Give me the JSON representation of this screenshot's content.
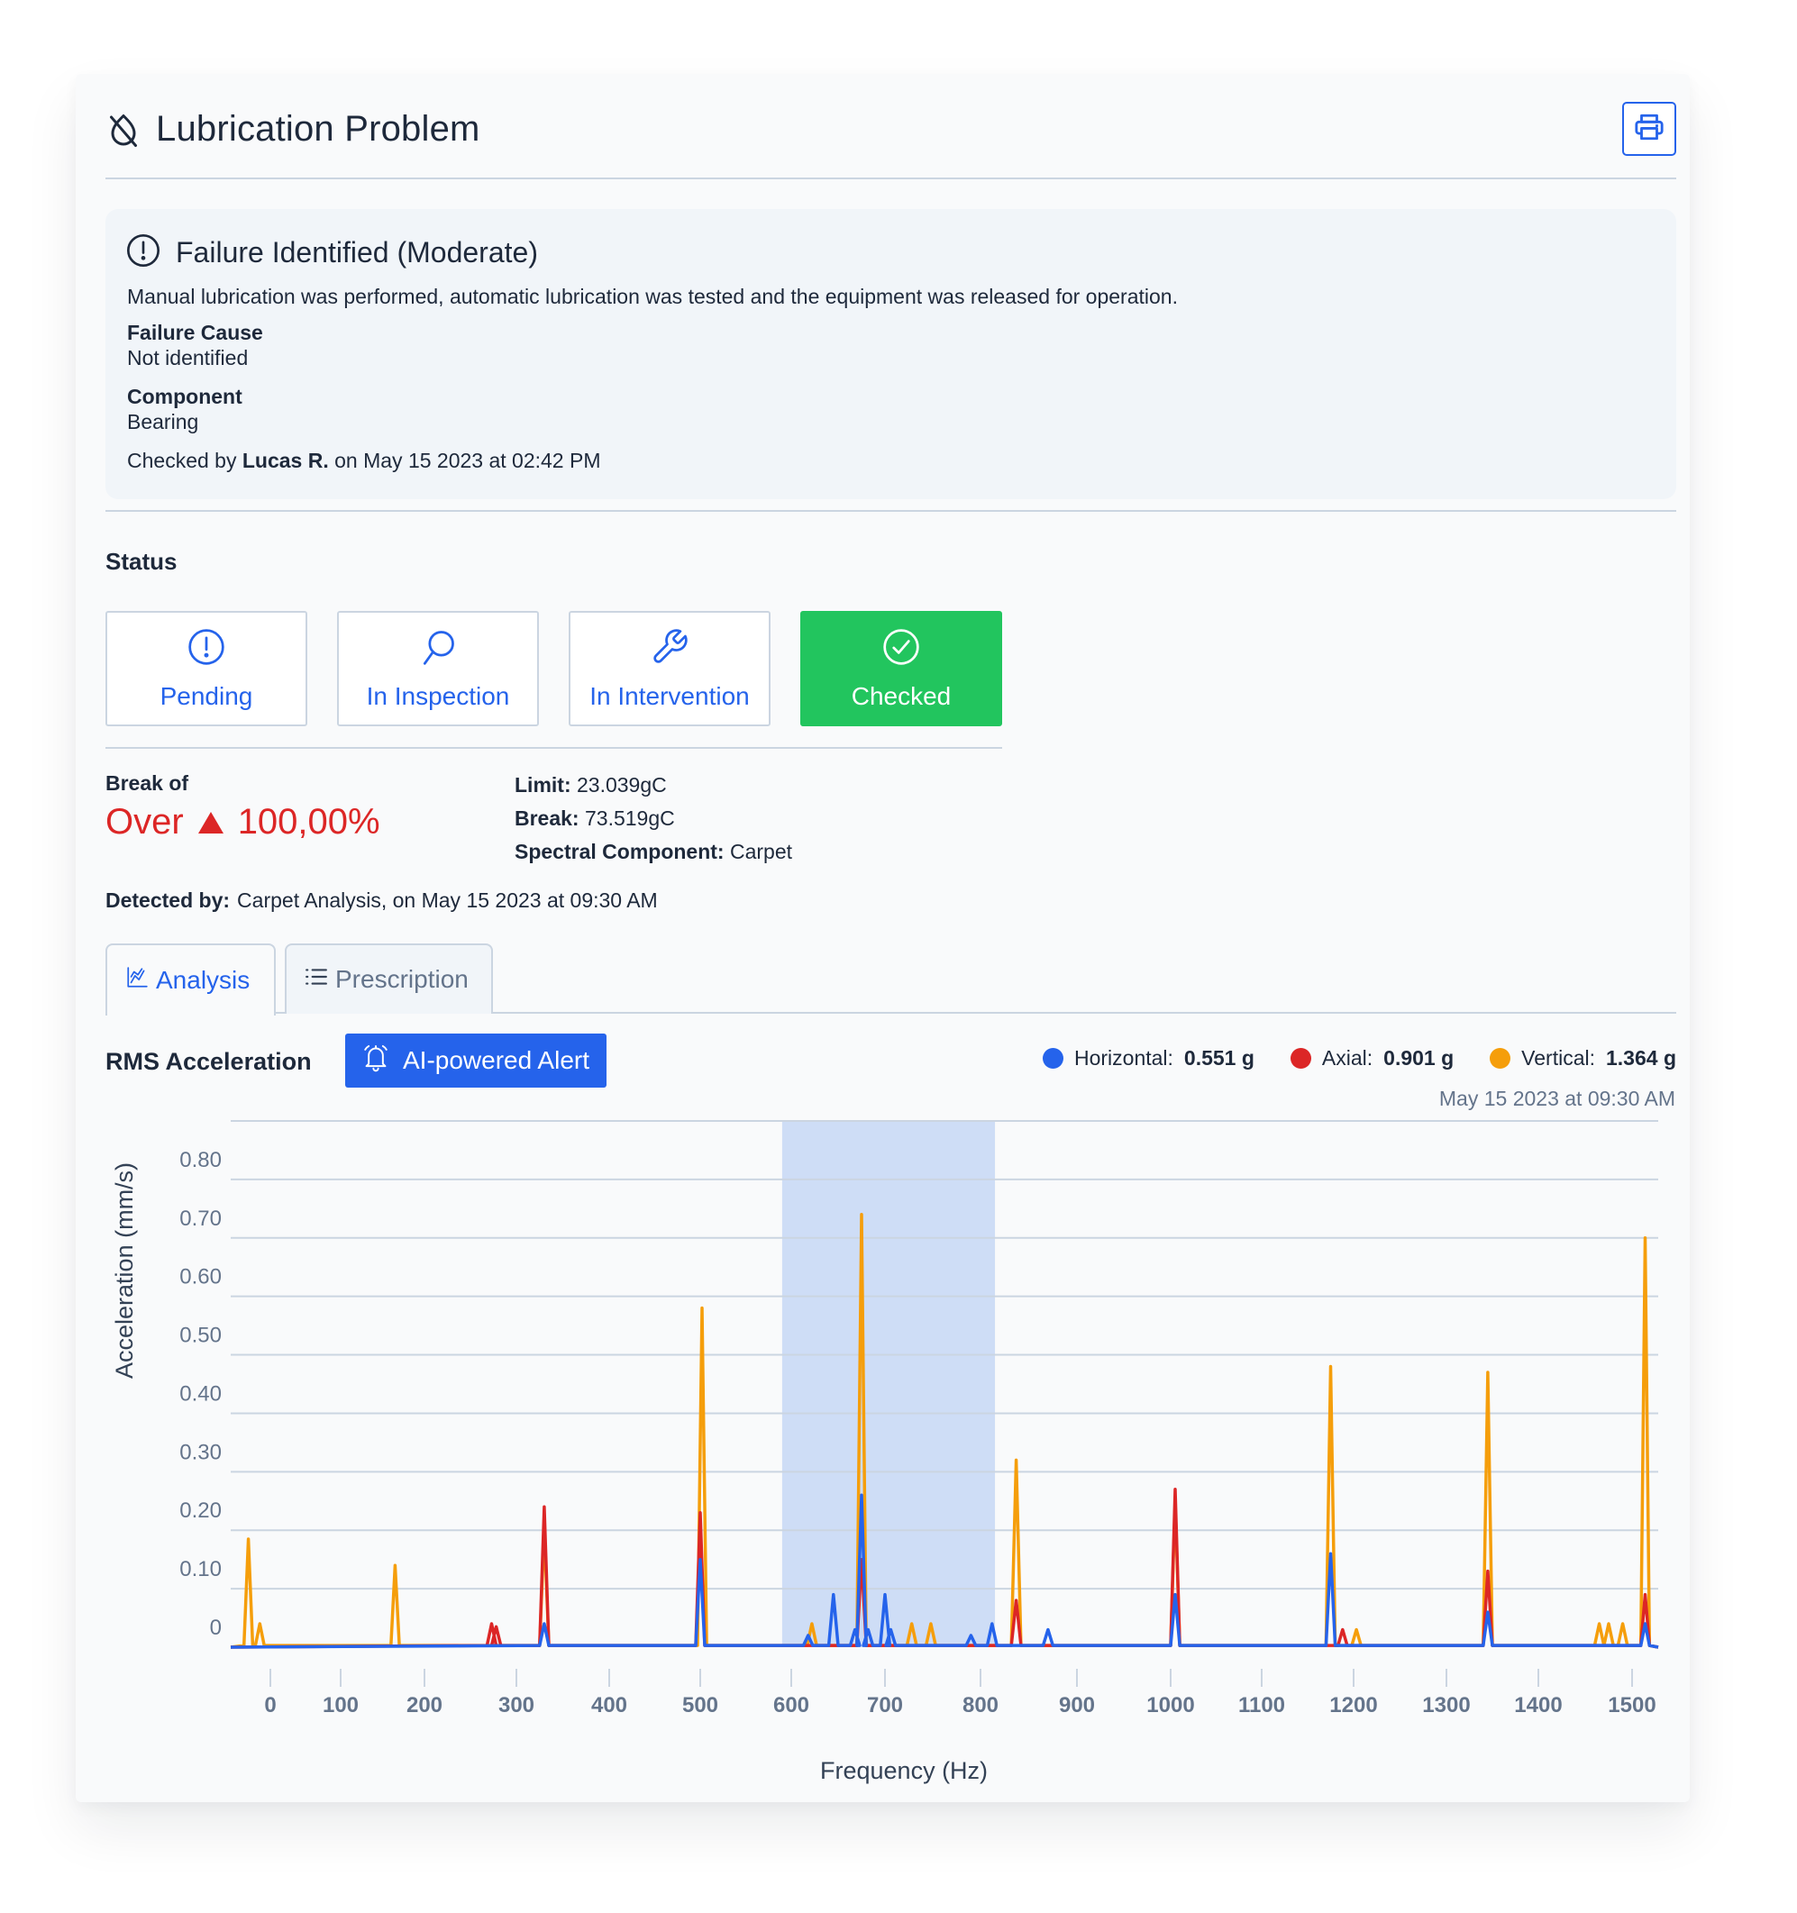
{
  "header": {
    "title": "Lubrication Problem",
    "title_icon": "droplet-off-icon",
    "print_icon": "printer-icon"
  },
  "failure": {
    "icon": "alert-circle-icon",
    "heading": "Failure Identified (Moderate)",
    "description": "Manual lubrication was performed, automatic lubrication was tested and the equipment was released for operation.",
    "cause_label": "Failure Cause",
    "cause_value": "Not identified",
    "component_label": "Component",
    "component_value": "Bearing",
    "checked_prefix": "Checked by",
    "checked_by": "Lucas R.",
    "checked_suffix": "on May 15 2023 at 02:42 PM"
  },
  "status": {
    "title": "Status",
    "buttons": [
      {
        "label": "Pending",
        "icon": "alert-circle-icon",
        "active": false
      },
      {
        "label": "In Inspection",
        "icon": "search-icon",
        "active": false
      },
      {
        "label": "In Intervention",
        "icon": "wrench-icon",
        "active": false
      },
      {
        "label": "Checked",
        "icon": "check-circle-icon",
        "active": true
      }
    ]
  },
  "break": {
    "label": "Break of",
    "direction": "Over",
    "value": "100,00%",
    "limit_label": "Limit:",
    "limit_value": "23.039gC",
    "break_label": "Break:",
    "break_value": "73.519gC",
    "spectral_label": "Spectral Component:",
    "spectral_value": "Carpet",
    "detected_label": "Detected by:",
    "detected_value": "Carpet Analysis, on May 15 2023 at 09:30 AM"
  },
  "tabs": [
    {
      "label": "Analysis",
      "icon": "chart-line-icon",
      "active": true
    },
    {
      "label": "Prescription",
      "icon": "list-icon",
      "active": false
    }
  ],
  "chart_header": {
    "title": "RMS Acceleration",
    "alert_button": "AI-powered Alert",
    "alert_icon": "bell-icon",
    "legend": [
      {
        "name": "Horizontal:",
        "value": "0.551 g",
        "color": "#2563eb"
      },
      {
        "name": "Axial:",
        "value": "0.901 g",
        "color": "#dc2626"
      },
      {
        "name": "Vertical:",
        "value": "1.364 g",
        "color": "#f59e0b"
      }
    ],
    "date": "May 15 2023 at 09:30 AM"
  },
  "colors": {
    "accent": "#2563eb",
    "success": "#22c55e",
    "danger": "#dc2626",
    "warning": "#f59e0b",
    "highlight": "#c7d7f4"
  },
  "chart_data": {
    "type": "line",
    "title": "RMS Acceleration",
    "xlabel": "Frequency (Hz)",
    "ylabel": "Acceleration (mm/s)",
    "x_ticks": [
      0,
      100,
      200,
      300,
      400,
      500,
      600,
      700,
      800,
      900,
      1000,
      1100,
      1200,
      1300,
      1400,
      1500
    ],
    "y_ticks": [
      "0",
      "0.10",
      "0.20",
      "0.30",
      "0.40",
      "0.50",
      "0.60",
      "0.70",
      "0.80"
    ],
    "xlim": [
      -45,
      1530
    ],
    "ylim": [
      0,
      0.9
    ],
    "grid": true,
    "highlight_band": [
      590,
      815
    ],
    "series": [
      {
        "name": "Horizontal",
        "color": "#2563eb",
        "peaks": [
          [
            330,
            0.04
          ],
          [
            500,
            0.15
          ],
          [
            618,
            0.02
          ],
          [
            645,
            0.09
          ],
          [
            668,
            0.03
          ],
          [
            675,
            0.26
          ],
          [
            682,
            0.03
          ],
          [
            700,
            0.09
          ],
          [
            706,
            0.03
          ],
          [
            790,
            0.02
          ],
          [
            812,
            0.04
          ],
          [
            870,
            0.03
          ],
          [
            1005,
            0.09
          ],
          [
            1175,
            0.16
          ],
          [
            1345,
            0.06
          ],
          [
            1515,
            0.04
          ]
        ]
      },
      {
        "name": "Axial",
        "color": "#dc2626",
        "peaks": [
          [
            273,
            0.04
          ],
          [
            278,
            0.035
          ],
          [
            330,
            0.24
          ],
          [
            500,
            0.23
          ],
          [
            675,
            0.15
          ],
          [
            837,
            0.08
          ],
          [
            1005,
            0.27
          ],
          [
            1188,
            0.03
          ],
          [
            1345,
            0.13
          ],
          [
            1515,
            0.09
          ]
        ]
      },
      {
        "name": "Vertical",
        "color": "#f59e0b",
        "peaks": [
          [
            -25,
            0.185
          ],
          [
            -12,
            0.04
          ],
          [
            165,
            0.14
          ],
          [
            330,
            0.2
          ],
          [
            502,
            0.58
          ],
          [
            622,
            0.04
          ],
          [
            675,
            0.74
          ],
          [
            728,
            0.04
          ],
          [
            748,
            0.04
          ],
          [
            837,
            0.32
          ],
          [
            1005,
            0.25
          ],
          [
            1175,
            0.48
          ],
          [
            1203,
            0.03
          ],
          [
            1345,
            0.47
          ],
          [
            1465,
            0.04
          ],
          [
            1475,
            0.04
          ],
          [
            1490,
            0.04
          ],
          [
            1515,
            0.7
          ]
        ]
      }
    ]
  }
}
